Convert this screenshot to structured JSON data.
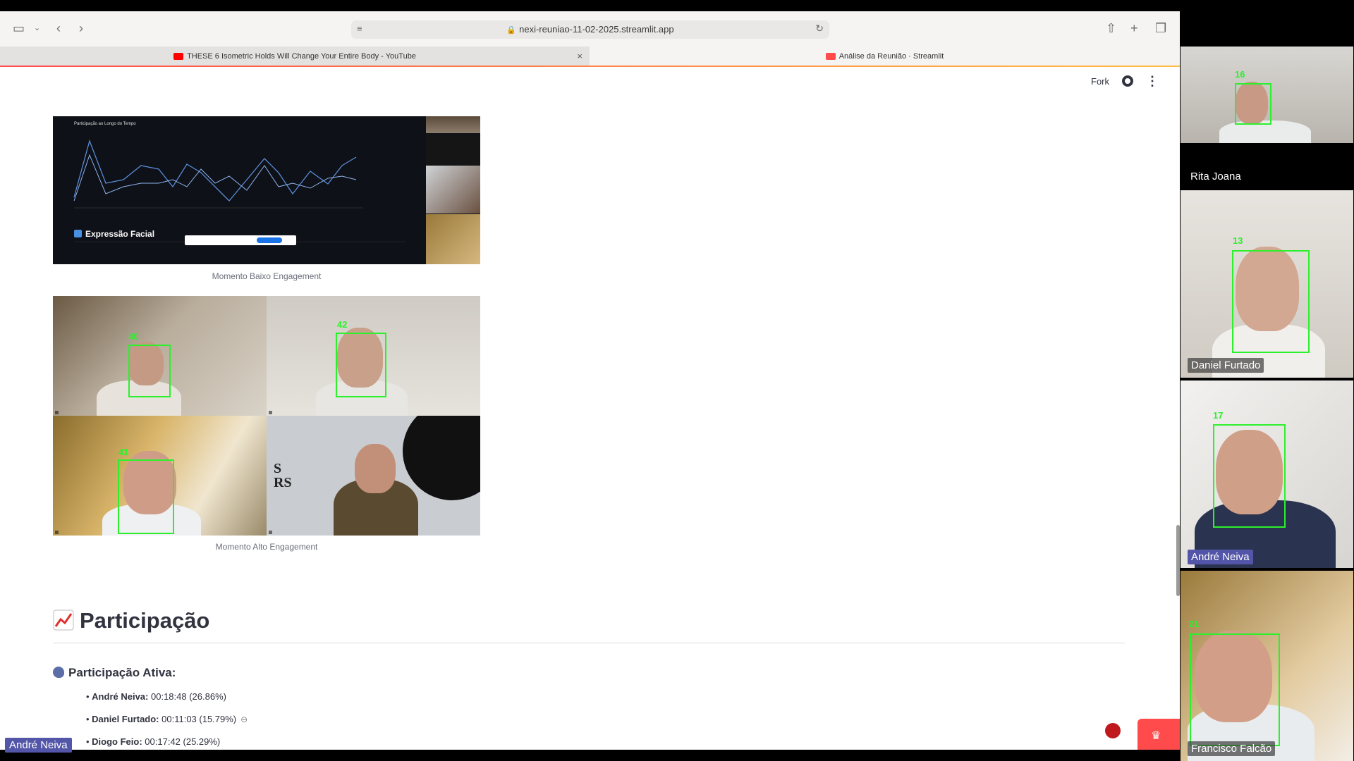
{
  "browser": {
    "url": "nexi-reuniao-11-02-2025.streamlit.app",
    "tabs": [
      {
        "title": "THESE 6 Isometric Holds Will Change Your Entire Body - YouTube",
        "favicon_color": "#ff0000"
      },
      {
        "title": "Análise da Reunião · Streamlit",
        "favicon_color": "#ff4b4b"
      }
    ],
    "close_glyph": "×"
  },
  "st_header": {
    "fork_label": "Fork"
  },
  "images": {
    "low_caption": "Momento Baixo Engagement",
    "high_caption": "Momento Alto Engagement",
    "inner_chart_title": "Participação ao Longo do Tempo",
    "inner_section": "Expressão Facial",
    "face_ids": [
      "40",
      "42",
      "41"
    ]
  },
  "section": {
    "title": "Participação",
    "subtitle": "Participação Ativa:",
    "participants": [
      {
        "name": "André Neiva:",
        "value": "00:18:48 (26.86%)"
      },
      {
        "name": "Daniel Furtado:",
        "value": "00:11:03 (15.79%)"
      },
      {
        "name": "Diogo Feio:",
        "value": "00:17:42 (25.29%)"
      }
    ]
  },
  "video_tiles": [
    {
      "name": "Rita Joana",
      "face_id": "16"
    },
    {
      "name": "Daniel Furtado",
      "face_id": "13"
    },
    {
      "name": "André Neiva",
      "face_id": "17"
    },
    {
      "name": "Francisco Falcão",
      "face_id": "21"
    }
  ],
  "bottom_tag": "André Neiva",
  "colors": {
    "accent": "#ff4b4b",
    "detection_box": "#2df02d",
    "name_highlight": "#5356a8"
  }
}
